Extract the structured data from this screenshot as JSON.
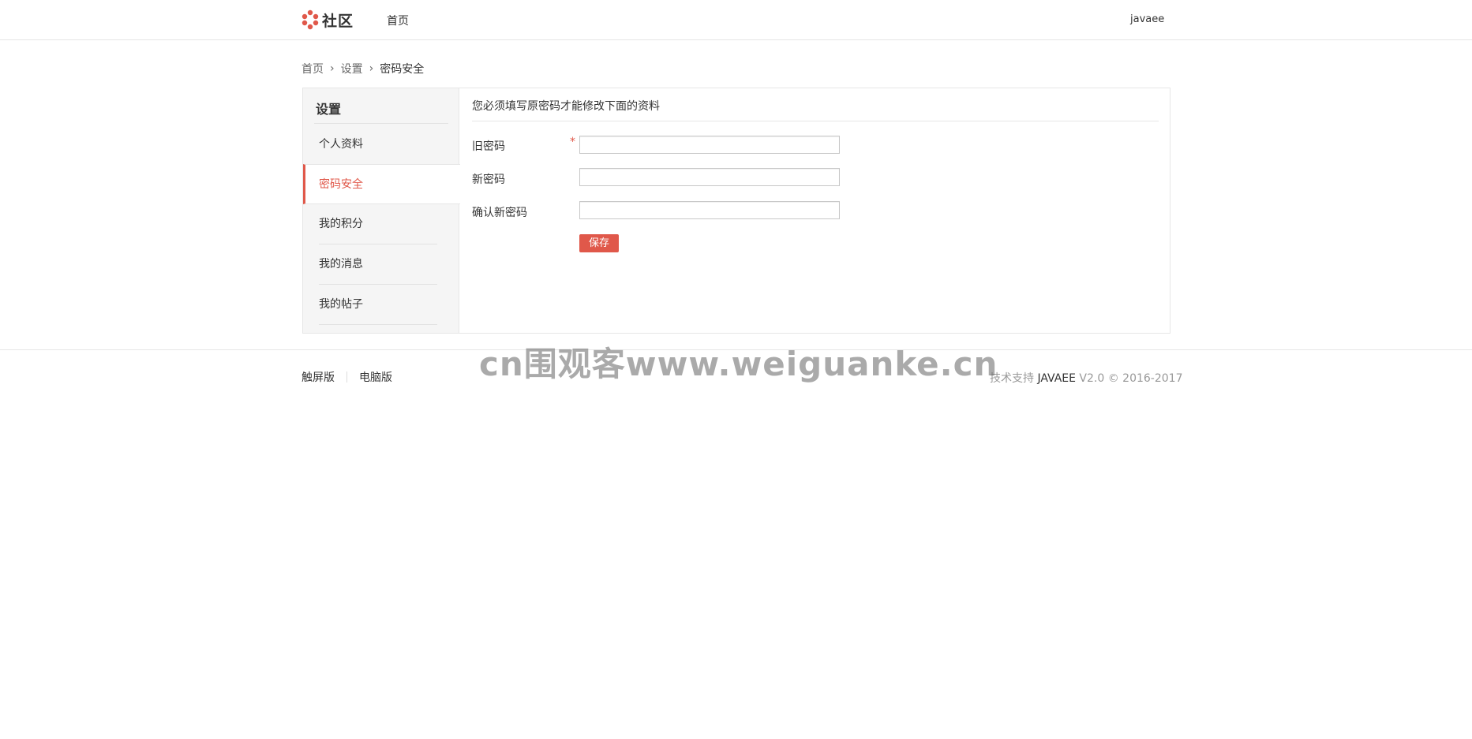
{
  "header": {
    "logo_text": "社区",
    "nav_home": "首页",
    "username": "javaee"
  },
  "breadcrumb": {
    "items": [
      "首页",
      "设置",
      "密码安全"
    ],
    "separator": "›"
  },
  "sidebar": {
    "title": "设置",
    "items": [
      {
        "label": "个人资料"
      },
      {
        "label": "密码安全"
      },
      {
        "label": "我的积分"
      },
      {
        "label": "我的消息"
      },
      {
        "label": "我的帖子"
      }
    ],
    "active_index": 1
  },
  "form": {
    "notice": "您必须填写原密码才能修改下面的资料",
    "old_password_label": "旧密码",
    "required_mark": "*",
    "new_password_label": "新密码",
    "confirm_password_label": "确认新密码",
    "old_password_value": "",
    "new_password_value": "",
    "confirm_password_value": "",
    "save_label": "保存"
  },
  "footer": {
    "link_touch": "触屏版",
    "link_desktop": "电脑版",
    "support_prefix": "技术支持",
    "support_brand": "JAVAEE",
    "support_suffix": "V2.0 © 2016-2017"
  },
  "watermark": "cn围观客www.weiguanke.cn",
  "colors": {
    "accent": "#e0584a",
    "border": "#e6e6e6",
    "sidebar_bg": "#f5f5f5"
  }
}
